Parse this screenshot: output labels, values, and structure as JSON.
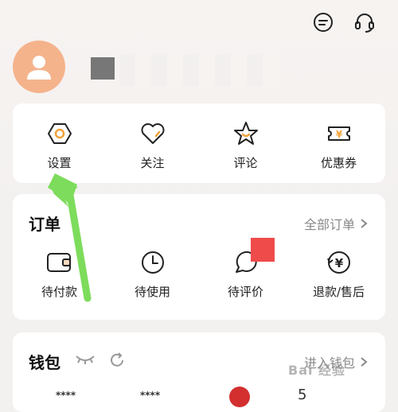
{
  "header": {
    "icons": [
      "message-icon",
      "customer-service-icon"
    ]
  },
  "profile": {
    "avatar_icon": "user-avatar-icon"
  },
  "shortcuts": [
    {
      "label": "设置",
      "icon": "settings-icon"
    },
    {
      "label": "关注",
      "icon": "heart-icon"
    },
    {
      "label": "评论",
      "icon": "star-comment-icon"
    },
    {
      "label": "优惠券",
      "icon": "coupon-icon"
    }
  ],
  "orders": {
    "title": "订单",
    "more": "全部订单",
    "items": [
      {
        "label": "待付款",
        "icon": "wallet-icon"
      },
      {
        "label": "待使用",
        "icon": "clock-icon"
      },
      {
        "label": "待评价",
        "icon": "chat-bubble-icon"
      },
      {
        "label": "退款/售后",
        "icon": "refund-icon"
      }
    ]
  },
  "wallet": {
    "title": "钱包",
    "more": "进入钱包",
    "masked_values": [
      "****",
      "****"
    ],
    "partial_value": "5"
  },
  "watermark": "Bai 经验",
  "colors": {
    "accent": "#f2a23a",
    "arrow": "#7ddc5c",
    "avatar": "#f5b38c",
    "red_block": "#f04b4b"
  }
}
